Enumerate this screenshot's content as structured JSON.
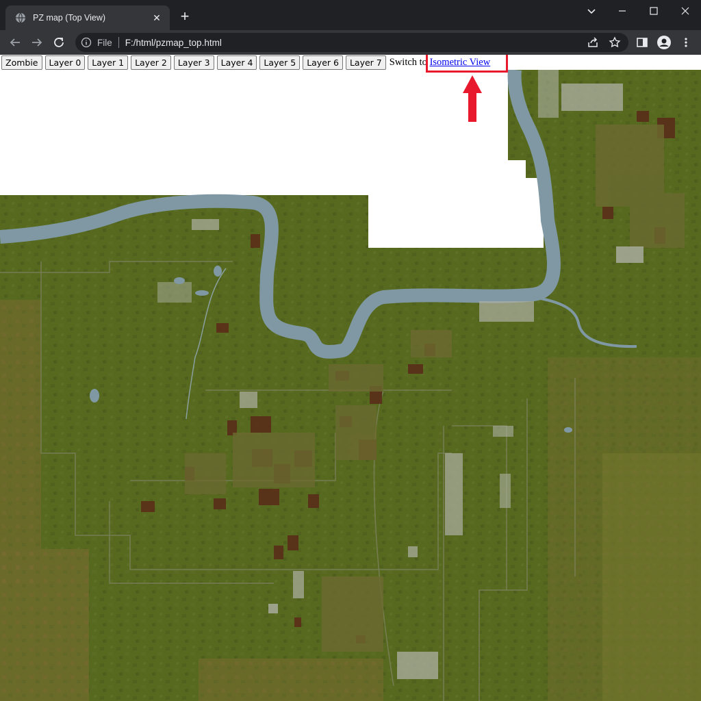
{
  "browser": {
    "tab": {
      "title": "PZ map (Top View)",
      "favicon": "globe-icon"
    },
    "address": {
      "scheme": "File",
      "url": "F:/html/pzmap_top.html"
    },
    "icons": [
      "back-arrow-icon",
      "forward-arrow-icon",
      "reload-icon",
      "info-icon",
      "share-icon",
      "star-icon",
      "side-panel-icon",
      "profile-icon",
      "more-vert-icon"
    ]
  },
  "controls": {
    "buttons": [
      "Zombie",
      "Layer 0",
      "Layer 1",
      "Layer 2",
      "Layer 3",
      "Layer 4",
      "Layer 5",
      "Layer 6",
      "Layer 7"
    ],
    "switch_label": "Switch to ",
    "switch_link": "Isometric View"
  },
  "colors": {
    "terrain": "#556a22",
    "forest": "#4b5e1e",
    "river": "#7f98a3",
    "field": "#5a2a18",
    "annotation": "#e8192c",
    "link": "#0000ee"
  }
}
